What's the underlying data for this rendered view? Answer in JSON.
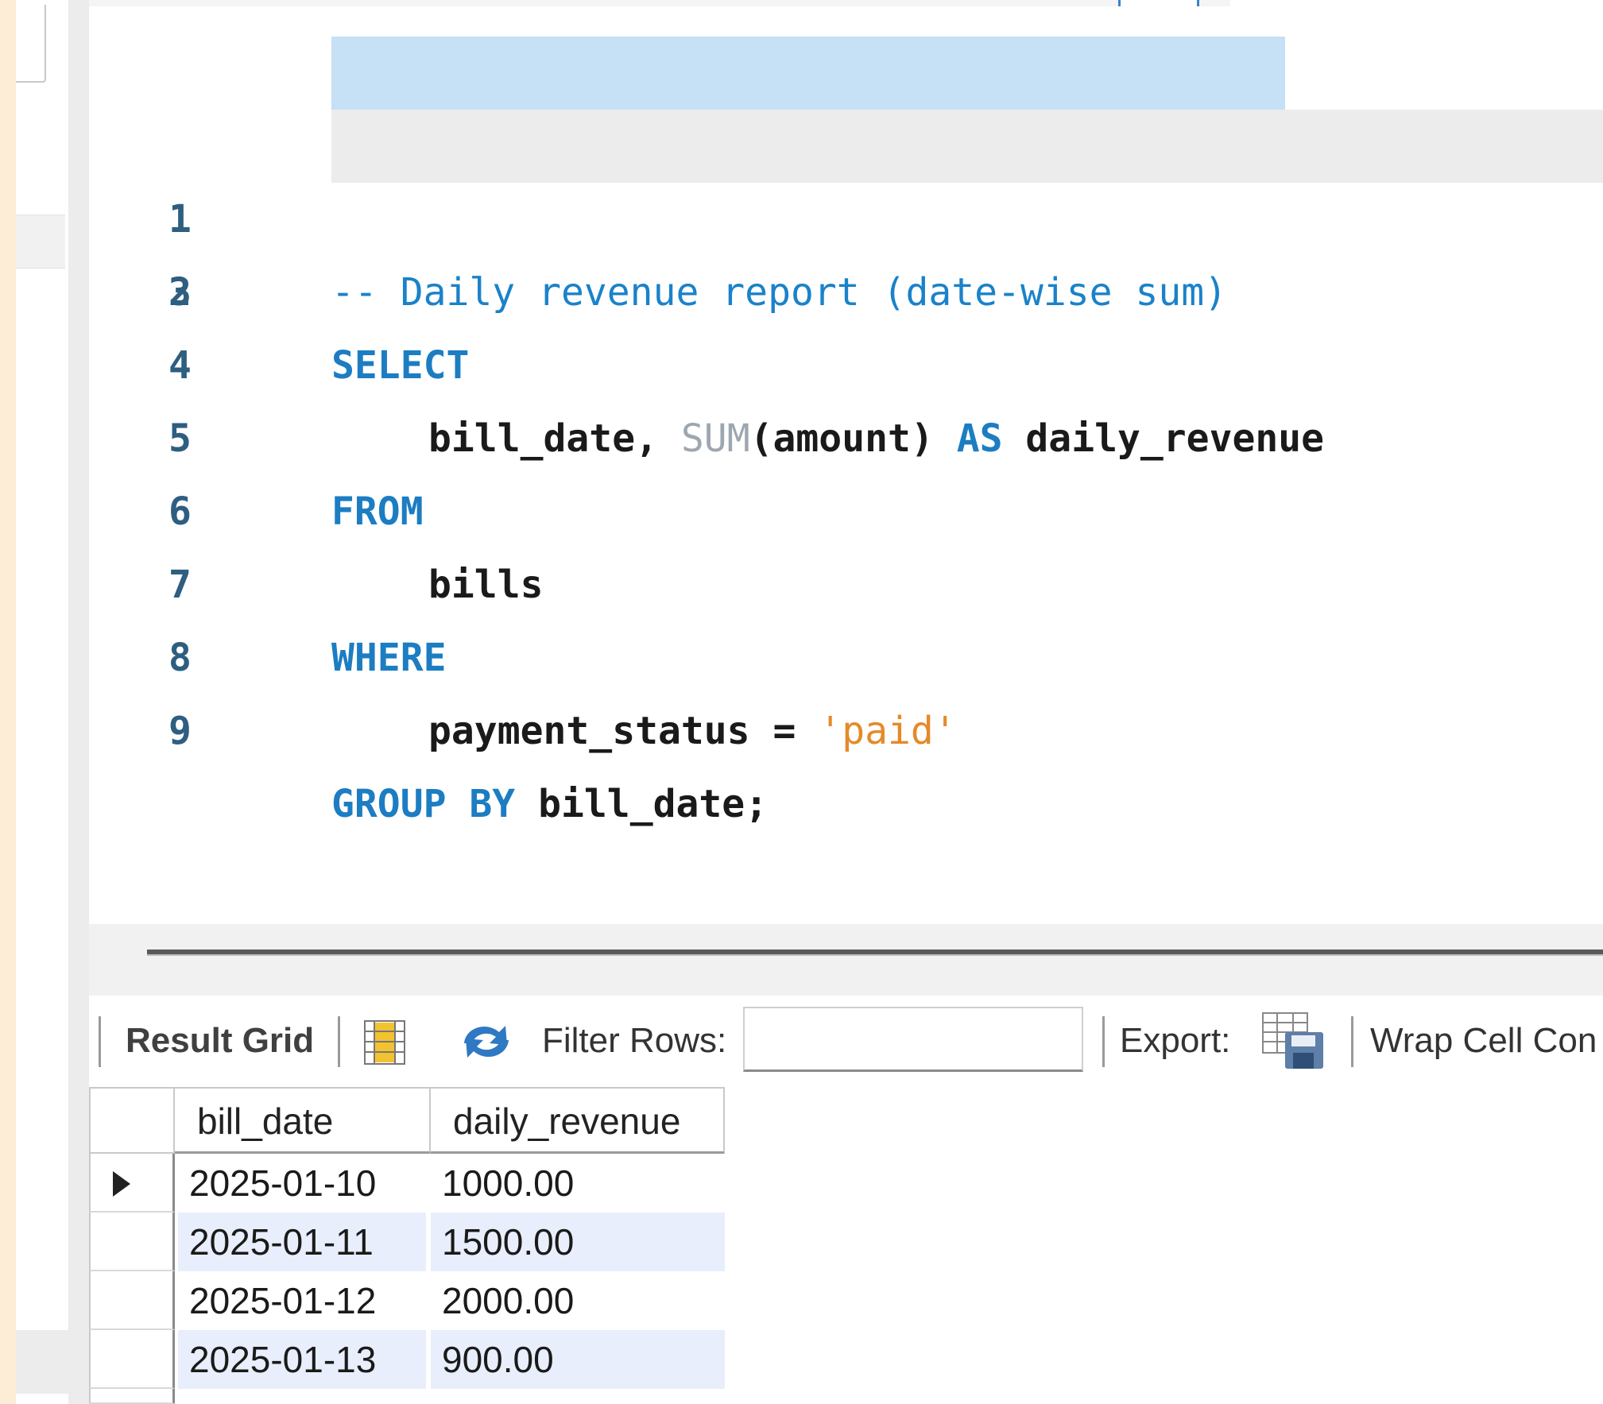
{
  "editor": {
    "lines": [
      {
        "num": "1",
        "comment": "-- Daily revenue report (date-wise sum)"
      },
      {
        "num": "2"
      },
      {
        "num": "3",
        "kw": "SELECT"
      },
      {
        "num": "4",
        "col1": "bill_date,",
        "fn": "SUM",
        "arg": "(amount)",
        "kw": "AS",
        "alias": "daily_revenue"
      },
      {
        "num": "5",
        "kw": "FROM"
      },
      {
        "num": "6",
        "table": "bills"
      },
      {
        "num": "7",
        "kw": "WHERE"
      },
      {
        "num": "8",
        "col": "payment_status",
        "op": "=",
        "str": "'paid'"
      },
      {
        "num": "9",
        "kw1": "GROUP",
        "kw2": "BY",
        "col": "bill_date;"
      }
    ]
  },
  "result_toolbar": {
    "result_grid_label": "Result Grid",
    "filter_rows_label": "Filter Rows:",
    "filter_value": "",
    "export_label": "Export:",
    "wrap_label": "Wrap Cell Con"
  },
  "grid": {
    "columns": [
      "bill_date",
      "daily_revenue"
    ],
    "rows": [
      [
        "2025-01-10",
        "1000.00"
      ],
      [
        "2025-01-11",
        "1500.00"
      ],
      [
        "2025-01-12",
        "2000.00"
      ],
      [
        "2025-01-13",
        "900.00"
      ]
    ]
  },
  "colors": {
    "keyword": "#1c7dc2",
    "string": "#e48a2a",
    "comment_highlight": "#c6e0f5",
    "row_alt": "#e8eefb"
  }
}
